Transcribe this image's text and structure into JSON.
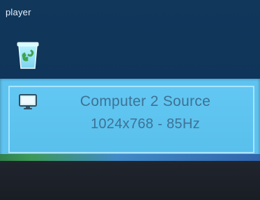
{
  "desktop": {
    "label": "player",
    "icon": "recycle-bin-icon"
  },
  "osd": {
    "icon": "monitor-icon",
    "line1": "Computer 2 Source",
    "line2": "1024x768 - 85Hz"
  },
  "colors": {
    "desktop_bg": "#11375b",
    "osd_bg": "#5fc3f0",
    "osd_text": "#3d7294",
    "taskbar_green": "#3b9750",
    "taskbar_blue": "#3f87c5"
  }
}
